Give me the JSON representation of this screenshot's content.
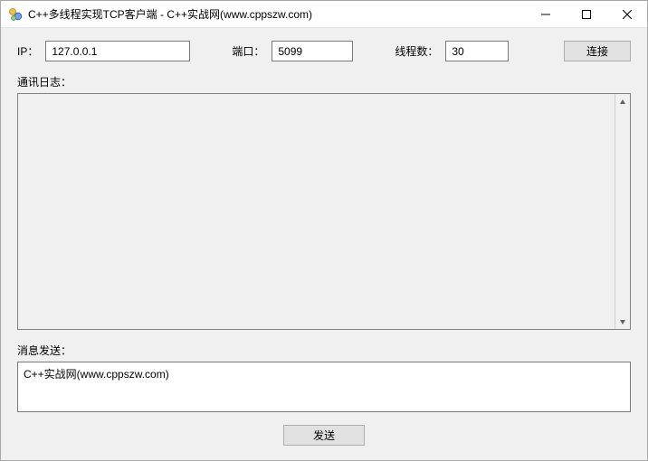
{
  "window": {
    "title": "C++多线程实现TCP客户端 - C++实战网(www.cppszw.com)"
  },
  "form": {
    "ip_label": "IP：",
    "ip_value": "127.0.0.1",
    "port_label": "端口：",
    "port_value": "5099",
    "threads_label": "线程数：",
    "threads_value": "30",
    "connect_label": "连接"
  },
  "log": {
    "label": "通讯日志：",
    "content": ""
  },
  "send": {
    "label": "消息发送：",
    "value": "C++实战网(www.cppszw.com)",
    "button": "发送"
  }
}
